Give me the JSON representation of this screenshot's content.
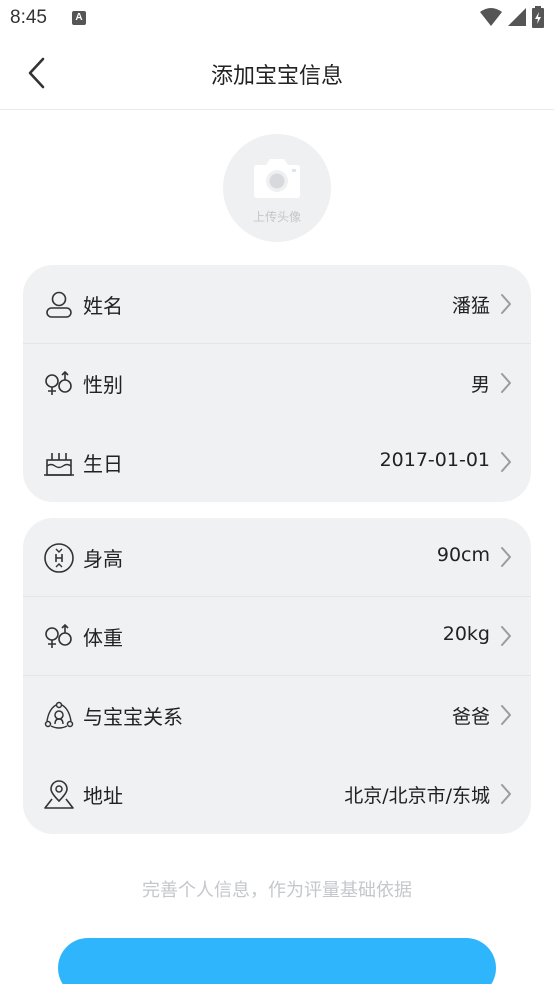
{
  "status_bar": {
    "time": "8:45",
    "notification_badge": "A"
  },
  "nav": {
    "title": "添加宝宝信息"
  },
  "avatar": {
    "label": "上传头像"
  },
  "basic_info": {
    "rows": [
      {
        "label": "姓名",
        "value": "潘猛",
        "icon": "user-icon"
      },
      {
        "label": "性别",
        "value": "男",
        "icon": "gender-icon"
      },
      {
        "label": "生日",
        "value": "2017-01-01",
        "icon": "cake-icon"
      }
    ]
  },
  "body_info": {
    "rows": [
      {
        "label": "身高",
        "value": "90cm",
        "icon": "height-icon"
      },
      {
        "label": "体重",
        "value": "20kg",
        "icon": "weight-icon"
      },
      {
        "label": "与宝宝关系",
        "value": "爸爸",
        "icon": "relationship-icon"
      },
      {
        "label": "地址",
        "value": "北京/北京市/东城",
        "icon": "location-icon"
      }
    ]
  },
  "hint": "完善个人信息，作为评量基础依据",
  "colors": {
    "accent": "#2fb5fb",
    "card_bg": "#f0f1f3",
    "hint": "#c5c7cc"
  }
}
